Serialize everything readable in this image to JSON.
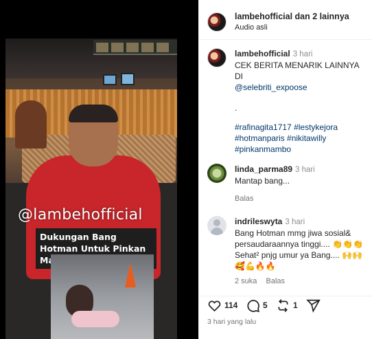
{
  "post": {
    "author": "lambehofficial",
    "collab_text": "dan 2 lainnya",
    "audio": "Audio asli",
    "watermark": "@lambehofficial",
    "caption_overlay": "Dukungan Bang Hotman Untuk Pinkan Mambo 👍"
  },
  "caption": {
    "user": "lambehofficial",
    "time": "3 hari",
    "text": "CEK BERITA MENARIK LAINNYA DI",
    "mention": "@selebriti_expoose",
    "dot": ".",
    "hashtags_line1": "#rafinagita1717 #lestykejora",
    "hashtags_line2": "#hotmanparis #nikitawilly",
    "hashtags_line3": "#pinkanmambo"
  },
  "comments": [
    {
      "user": "linda_parma89",
      "time": "3 hari",
      "text": "Mantap bang...",
      "reply_label": "Balas"
    },
    {
      "user": "indrileswyta",
      "time": "3 hari",
      "text_line1": "Bang Hotman mmg jiwa sosial&",
      "text_line2": "persaudaraannya tinggi.... 👏👏👏",
      "text_line3": "Sehat² pnjg umur ya Bang.... 🙌🙌",
      "text_line4": "🥰💪🔥🔥",
      "likes_label": "2 suka",
      "reply_label": "Balas"
    }
  ],
  "actions": {
    "likes": "114",
    "comments": "5",
    "reposts": "1",
    "icons": [
      "heart-icon",
      "comment-icon",
      "repost-icon",
      "share-icon"
    ]
  },
  "footer": {
    "time": "3 hari yang lalu"
  },
  "colors": {
    "link": "#00376b",
    "muted": "#737373",
    "text": "#262626"
  }
}
